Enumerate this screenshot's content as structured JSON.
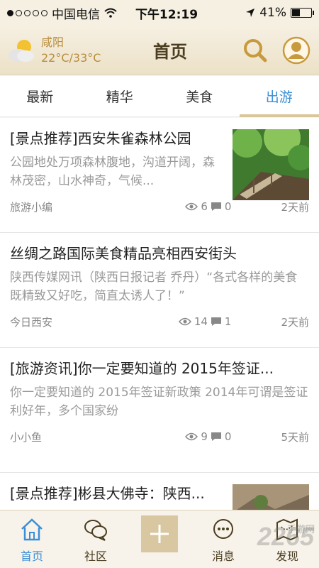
{
  "status": {
    "carrier": "中国电信",
    "time": "下午12:19",
    "battery": "41%",
    "battery_level": 0.41
  },
  "header": {
    "city": "咸阳",
    "temperature": "22°C/33°C",
    "title": "首页"
  },
  "tabs": [
    {
      "label": "最新"
    },
    {
      "label": "精华"
    },
    {
      "label": "美食"
    },
    {
      "label": "出游"
    }
  ],
  "articles": [
    {
      "title": "[景点推荐]西安朱雀森林公园",
      "summary": "公园地处万项森林腹地，沟道开阔，森林茂密，山水神奇，气候...",
      "source": "旅游小编",
      "views": "6",
      "comments": "0",
      "time": "2天前"
    },
    {
      "title": "丝绸之路国际美食精品亮相西安街头",
      "summary": "陕西传媒网讯（陕西日报记者 乔丹）“各式各样的美食既精致又好吃，简直太诱人了！”",
      "source": "今日西安",
      "views": "14",
      "comments": "1",
      "time": "2天前"
    },
    {
      "title": "[旅游资讯]你一定要知道的 2015年签证...",
      "summary": "你一定要知道的 2015年签证新政策   2014年可谓是签证利好年，多个国家纷",
      "source": "小小鱼",
      "views": "9",
      "comments": "0",
      "time": "5天前"
    },
    {
      "title": "[景点推荐]彬县大佛寺：陕西..."
    }
  ],
  "tabbar": [
    {
      "label": "首页"
    },
    {
      "label": "社区"
    },
    {
      "label": "消息"
    },
    {
      "label": "发现"
    }
  ],
  "watermark": {
    "text": "2265",
    "sub": "手游网"
  }
}
